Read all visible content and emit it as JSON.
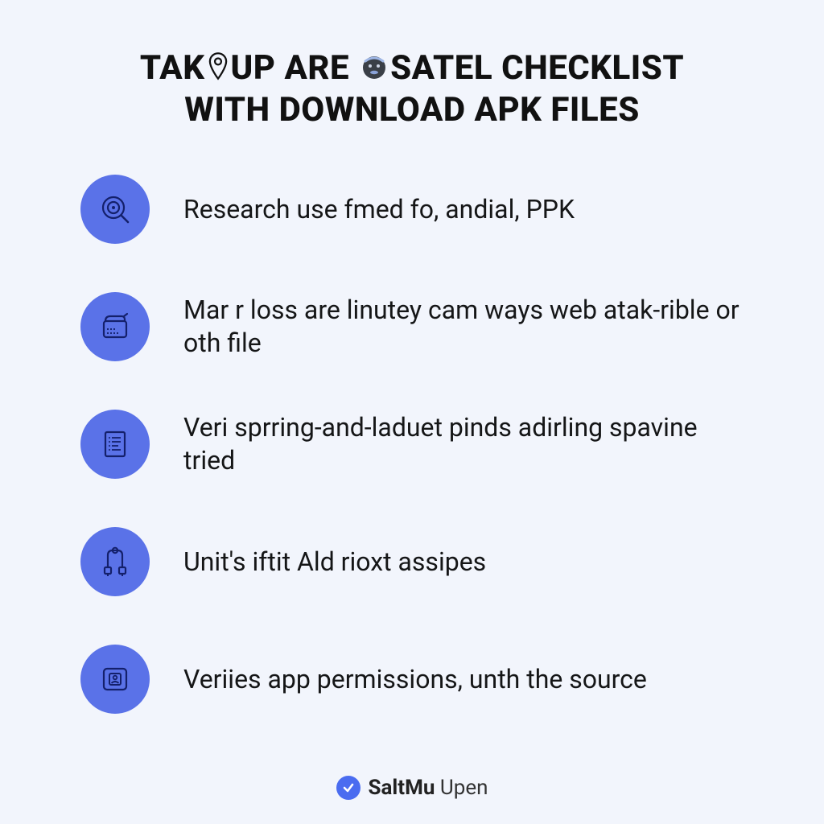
{
  "title": {
    "line1_pre": "TAK",
    "line1_mid": "UP ARE ",
    "line1_post": "SATEL CHECKLIST",
    "line2": "WITH DOWNLOAD APK FILES"
  },
  "items": [
    {
      "text": "Research use fmed fo, andial, PPK"
    },
    {
      "text": "Mar r loss are linutey cam ways web atak-rible or oth file"
    },
    {
      "text": "Veri sprring-and-laduet pinds adirling spavine tried"
    },
    {
      "text": "Unit's iftit Ald rioxt assipes"
    },
    {
      "text": "Veriies app permissions, unth the source"
    }
  ],
  "footer": {
    "brand_bold": "SaltMu",
    "brand_light": " Upen"
  }
}
